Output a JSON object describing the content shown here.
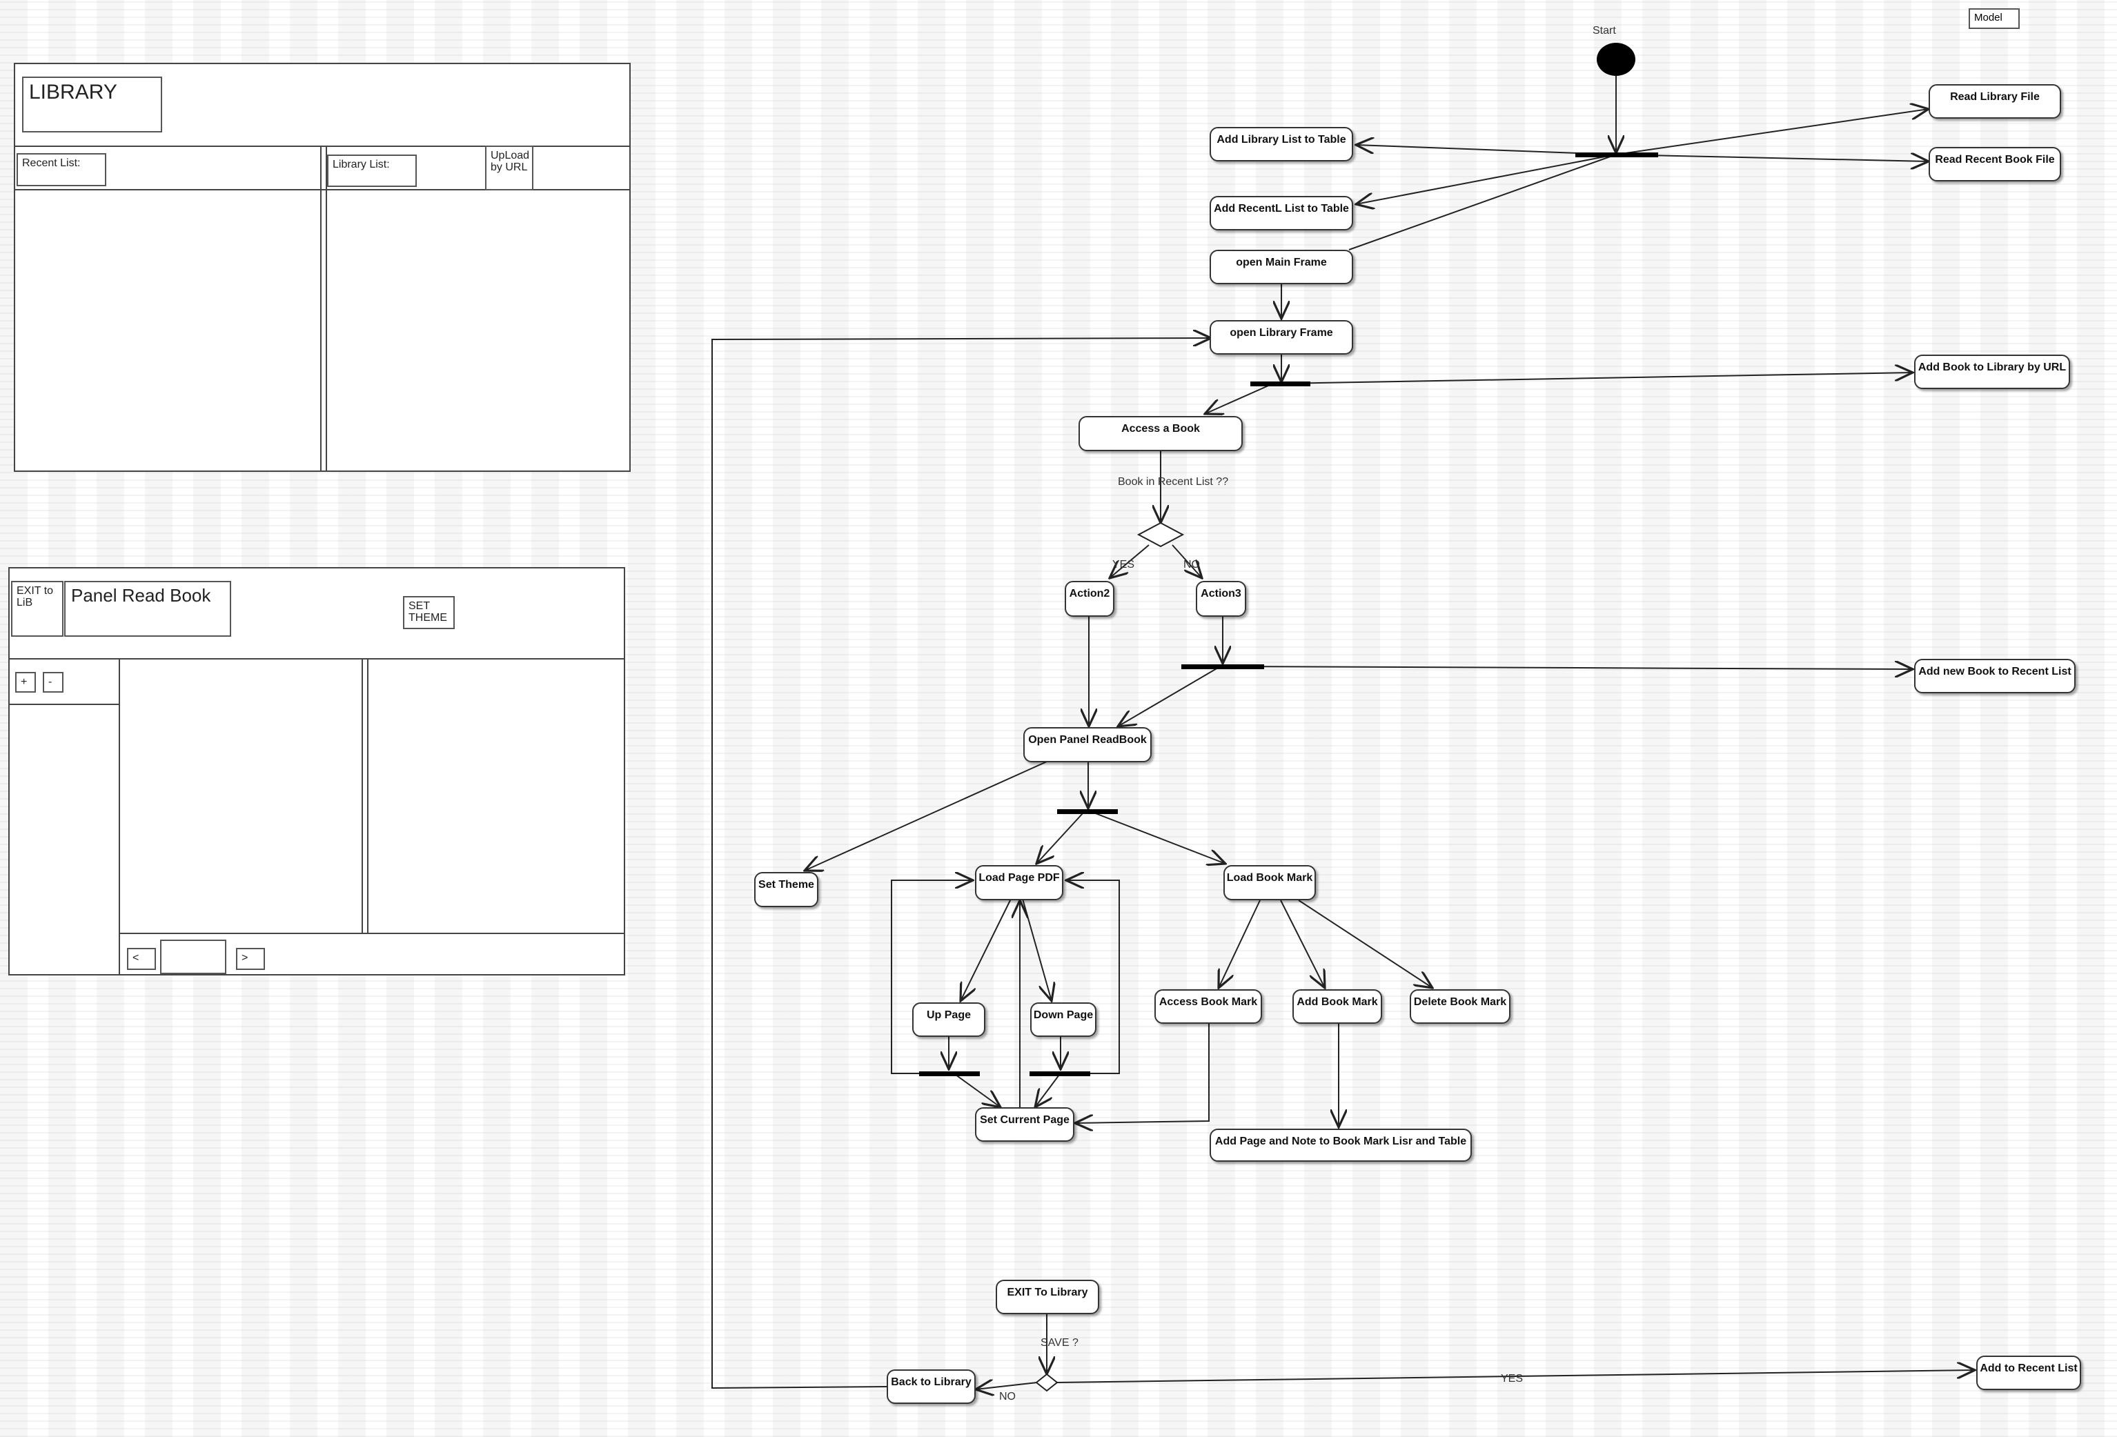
{
  "model_label": "Model",
  "library_wireframe": {
    "title": "LIBRARY",
    "recent_list_label": "Recent List:",
    "library_list_label": "Library List:",
    "upload_button": "UpLoad\nby URL"
  },
  "read_panel_wireframe": {
    "exit_button": "EXIT to\nLiB",
    "title": "Panel Read Book",
    "set_theme_button": "SET\nTHEME",
    "zoom_in": "+",
    "zoom_out": "-",
    "prev": "<",
    "next": ">"
  },
  "diagram": {
    "start_label": "Start",
    "nodes": {
      "read_library_file": "Read Library File",
      "read_recent_book_file": "Read Recent Book File",
      "add_library_list": "Add Library List to Table",
      "add_recent_list": "Add RecentL List to Table",
      "open_main_frame": "open Main Frame",
      "open_library_frame": "open Library Frame",
      "add_book_url": "Add Book to Library by URL",
      "access_book": "Access a Book",
      "action2": "Action2",
      "action3": "Action3",
      "add_new_recent": "Add new Book to Recent List",
      "open_panel": "Open Panel ReadBook",
      "set_theme": "Set Theme",
      "load_page_pdf": "Load Page PDF",
      "load_book_mark": "Load Book Mark",
      "up_page": "Up Page",
      "down_page": "Down Page",
      "access_book_mark": "Access Book Mark",
      "add_book_mark": "Add Book Mark",
      "delete_book_mark": "Delete Book Mark",
      "set_current_page": "Set Current Page",
      "add_page_note": "Add Page and Note to Book Mark Lisr and Table",
      "exit_to_library": "EXIT To Library",
      "back_to_library": "Back to Library",
      "add_to_recent": "Add to Recent List"
    },
    "labels": {
      "book_in_recent": "Book in Recent List ??",
      "yes1": "YES",
      "no1": "NO",
      "save": "SAVE ?",
      "yes2": "YES",
      "no2": "NO"
    }
  }
}
